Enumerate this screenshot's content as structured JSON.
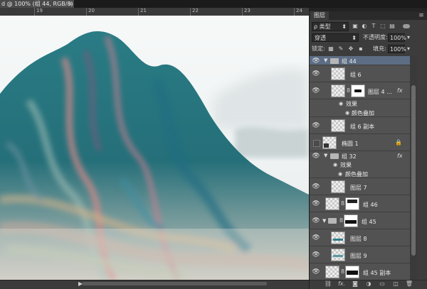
{
  "document_tab": {
    "title": "d @ 100% (组 44, RGB/8) *",
    "close": "×"
  },
  "ruler": {
    "numbers": [
      "19",
      "20",
      "21",
      "22",
      "23",
      "24",
      "25"
    ]
  },
  "status": {
    "arrow": "▶"
  },
  "layers_panel": {
    "tab_label": "图层",
    "menu_icon": "panel-menu-icon",
    "filter": {
      "search_glyph": "ρ",
      "value": "类型",
      "icons": [
        "image-filter-icon",
        "adjustment-filter-icon",
        "type-filter-icon",
        "shape-filter-icon",
        "smart-object-filter-icon"
      ]
    },
    "blend_mode": "穿透",
    "opacity": {
      "label": "不透明度:",
      "value": "100%"
    },
    "lock": {
      "label": "锁定:",
      "icons": [
        "lock-transparent-icon",
        "lock-paint-icon",
        "lock-position-icon",
        "lock-all-icon"
      ]
    },
    "fill": {
      "label": "填充:",
      "value": "100%"
    },
    "layers": [
      {
        "name": "组 44",
        "type": "group",
        "visible": true,
        "expanded": true,
        "selected": true
      },
      {
        "name": "组 6",
        "type": "layer",
        "visible": true
      },
      {
        "name": "图层 4 ...",
        "type": "layer-masked",
        "visible": true,
        "fx": "fx"
      },
      {
        "name": "效果",
        "type": "effects",
        "visible": true
      },
      {
        "name": "颜色叠加",
        "type": "effect",
        "visible": true
      },
      {
        "name": "组 6 副本",
        "type": "layer",
        "visible": true
      },
      {
        "name": "椭圆 1",
        "type": "shape-locked",
        "visible": false
      },
      {
        "name": "组 32",
        "type": "group",
        "visible": true,
        "expanded": true,
        "fx": "fx"
      },
      {
        "name": "效果",
        "type": "effects",
        "visible": true
      },
      {
        "name": "颜色叠加",
        "type": "effect",
        "visible": true
      },
      {
        "name": "图层 7",
        "type": "layer",
        "visible": true
      },
      {
        "name": "组 46",
        "type": "layer-masked",
        "visible": true
      },
      {
        "name": "组 45",
        "type": "group-masked",
        "visible": true,
        "expanded": true
      },
      {
        "name": "图层 8",
        "type": "layer",
        "visible": true
      },
      {
        "name": "图层 9",
        "type": "layer",
        "visible": true
      },
      {
        "name": "组 45 副本",
        "type": "layer-masked",
        "visible": true
      }
    ],
    "bottom_icons": [
      "link-layers-icon",
      "fx-icon",
      "add-mask-icon",
      "adjustment-layer-icon",
      "new-group-icon",
      "new-layer-icon",
      "delete-layer-icon"
    ],
    "fx_label": "fx."
  },
  "colors": {
    "teal": "#2f7f8a",
    "panel_bg": "#3c3c3c",
    "list_bg": "#525252",
    "selected_row": "#5c6d84"
  }
}
